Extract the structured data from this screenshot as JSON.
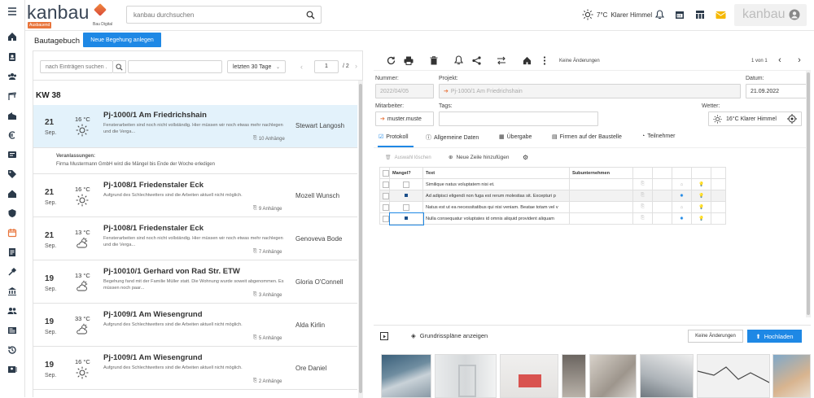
{
  "header": {
    "logo_text": "kanbau",
    "logo_badge": "Ausbauend",
    "logo_sub": "Bau Digital",
    "search_placeholder": "kanbau durchsuchen",
    "weather_temp": "7°C",
    "weather_text": "Klarer Himmel",
    "user_label": "kanbau"
  },
  "page": {
    "title": "Bautagebuch",
    "new_button": "Neue Begehung anlegen"
  },
  "list": {
    "search_placeholder": "nach Einträgen suchen ...",
    "filter_value": "letzten 30 Tage",
    "page_current": "1",
    "page_total": "/ 2",
    "week": "KW 38",
    "entries": [
      {
        "day": "21",
        "month": "Sep.",
        "temp": "16 °C",
        "weather": "sun-icon",
        "title": "Pj-1000/1 Am Friedrichshain",
        "desc": "Fensterarbeiten sind noch nicht vollständig. Hier müssen wir noch etwas mehr nachlegen und die Verga...",
        "person": "Stewart Langosh",
        "attachments": "10 Anhänge"
      },
      {
        "day": "21",
        "month": "Sep.",
        "temp": "16 °C",
        "weather": "sun-icon",
        "title": "Pj-1008/1 Friedenstaler Eck",
        "desc": "Aufgrund des Schlechtwetters sind die Arbeiten aktuell nicht möglich.",
        "person": "Mozell Wunsch",
        "attachments": "9 Anhänge"
      },
      {
        "day": "21",
        "month": "Sep.",
        "temp": "13 °C",
        "weather": "partly-cloudy-icon",
        "title": "Pj-1008/1 Friedenstaler Eck",
        "desc": "Fensterarbeiten sind noch nicht vollständig. Hier müssen wir noch etwas mehr nachlegen und die Verga...",
        "person": "Genoveva Bode",
        "attachments": "7 Anhänge"
      },
      {
        "day": "19",
        "month": "Sep.",
        "temp": "13 °C",
        "weather": "partly-cloudy-icon",
        "title": "Pj-10010/1 Gerhard von Rad Str. ETW",
        "desc": "Begehung fand mit der Familie Müller statt. Die Wohnung wurde soweit abgenommen. Es müssen noch paar...",
        "person": "Gloria O'Connell",
        "attachments": "3 Anhänge"
      },
      {
        "day": "19",
        "month": "Sep.",
        "temp": "33 °C",
        "weather": "partly-cloudy-icon",
        "title": "Pj-1009/1 Am Wiesengrund",
        "desc": "Aufgrund des Schlechtwetters sind die Arbeiten aktuell nicht möglich.",
        "person": "Alda Kirlin",
        "attachments": "5 Anhänge"
      },
      {
        "day": "19",
        "month": "Sep.",
        "temp": "16 °C",
        "weather": "sun-icon",
        "title": "Pj-1009/1 Am Wiesengrund",
        "desc": "Aufgrund des Schlechtwetters sind die Arbeiten aktuell nicht möglich.",
        "person": "Ore Daniel",
        "attachments": "2 Anhänge"
      }
    ],
    "note_label": "Veranlassungen:",
    "note_text": "Firma Mustermann GmbH wird die Mängel bis Ende der Woche erledigen"
  },
  "detail": {
    "status": "Keine Änderungen",
    "pager": "1 von 1",
    "number_label": "Nummer:",
    "number_value": "2022/04/05",
    "project_label": "Projekt:",
    "project_value": "Pj-1000/1 Am Friedrichshain",
    "date_label": "Datum:",
    "date_value": "21.09.2022",
    "staff_label": "Mitarbeiter:",
    "staff_value": "muster.muste",
    "tags_label": "Tags:",
    "weather_label": "Wetter:",
    "weather_value": "16°C  Klarer Himmel",
    "tabs": [
      "Protokoll",
      "Allgemeine Daten",
      "Übergabe",
      "Firmen auf der Baustelle",
      "Teilnehmer"
    ],
    "delete_selection": "Auswahl löschen",
    "add_row": "Neue Zeile hinzufügen",
    "table_headers": [
      "Mangel?",
      "Text",
      "Subunternehmen"
    ],
    "rows": [
      {
        "defect": false,
        "text": "Similique natus voluptatem nisi et."
      },
      {
        "defect": true,
        "text": "Ad adipisci eligendi non fuga est rerum molestias sit. Excepturi p"
      },
      {
        "defect": false,
        "text": "Natus est ut ea necessitatibus qui nisi veniam. Beatae totam vel v"
      },
      {
        "defect": true,
        "text": "Nulla consequatur voluptates id omnis aliquid provident aliquam"
      }
    ]
  },
  "attachments": {
    "floorplans": "Grundrisspläne anzeigen",
    "status": "Keine Änderungen",
    "upload": "Hochladen"
  },
  "colors": {
    "accent": "#1e88e5",
    "brand": "#e8743b",
    "selected_row": "#e3f2fb",
    "star": "#1e88e5",
    "bulb": "#f5b800"
  }
}
